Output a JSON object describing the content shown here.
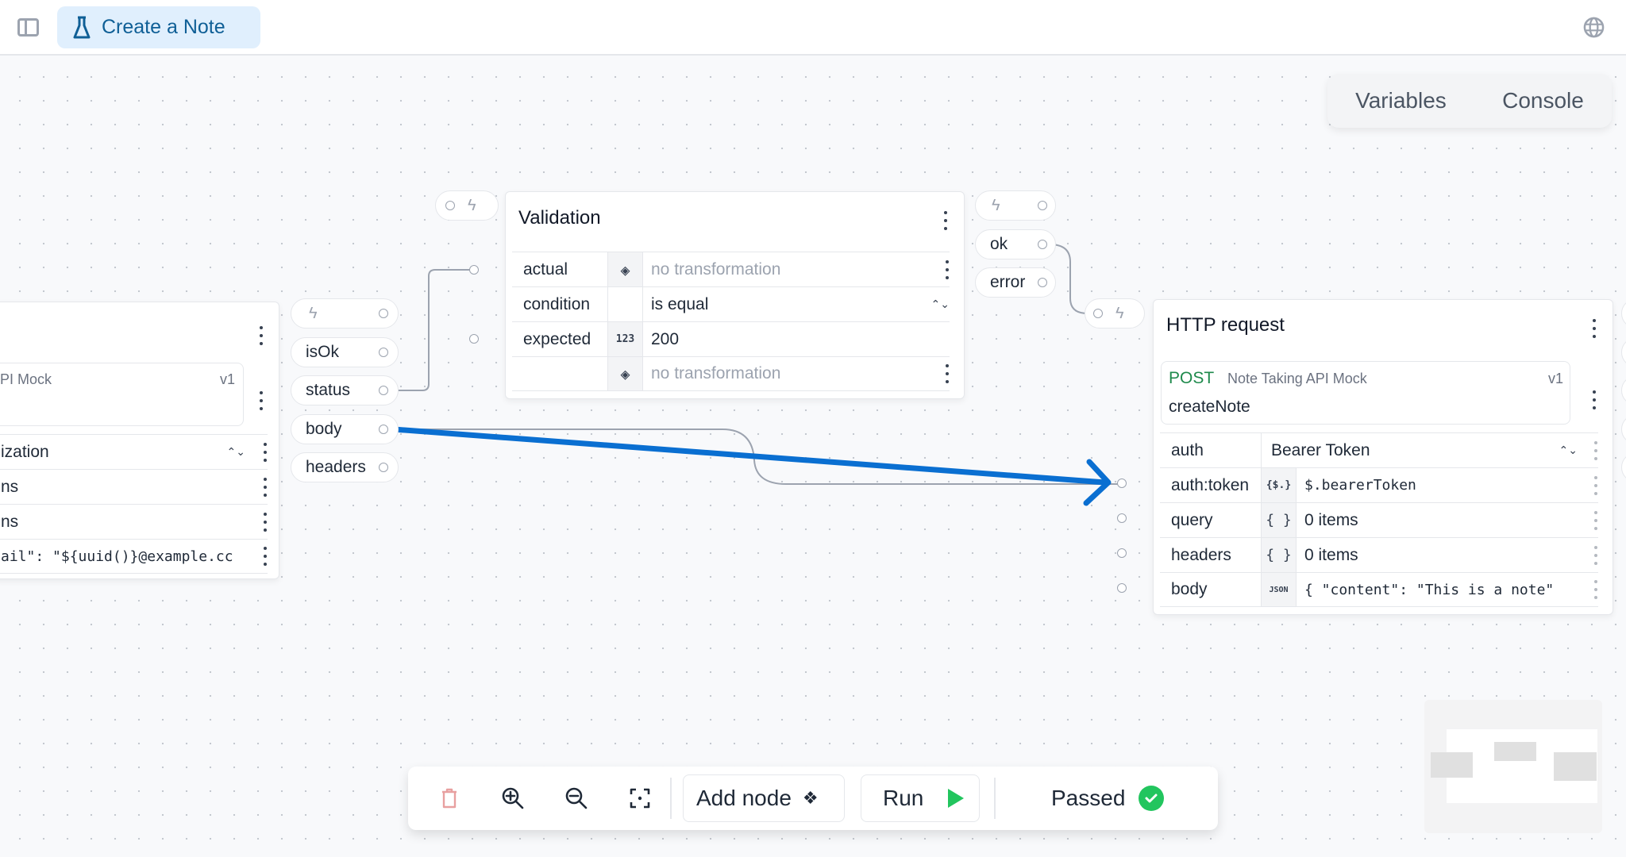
{
  "topbar": {
    "sidebar_toggle_icon": "sidebar-toggle-icon",
    "active_tab": {
      "label": "Create a Note",
      "icon": "flask-icon"
    },
    "language_icon": "globe-icon"
  },
  "panel_tabs": [
    "Variables",
    "Console"
  ],
  "left_node": {
    "service_fragment": "PI Mock",
    "version": "v1",
    "rows": [
      {
        "value_fragment": "ization"
      },
      {
        "value_fragment": "ns"
      },
      {
        "value_fragment": "ns"
      },
      {
        "value_fragment": "ail\": \"${uuid()}@example.cc"
      }
    ],
    "outputs": [
      {
        "label": "",
        "icon": "bolt-icon"
      },
      {
        "label": "isOk"
      },
      {
        "label": "status"
      },
      {
        "label": "body"
      },
      {
        "label": "headers"
      }
    ]
  },
  "validation_node": {
    "title": "Validation",
    "rows": [
      {
        "label": "actual",
        "icon": "transform-icon",
        "value": "no transformation",
        "placeholder": true
      },
      {
        "label": "condition",
        "icon": "",
        "value": "is equal",
        "select": true
      },
      {
        "label": "expected",
        "icon": "123",
        "value": "200"
      },
      {
        "label": "",
        "icon": "transform-icon",
        "value": "no transformation",
        "placeholder": true
      }
    ],
    "outputs": [
      {
        "label": "",
        "icon": "bolt-icon"
      },
      {
        "label": "ok"
      },
      {
        "label": "error"
      }
    ]
  },
  "http_node": {
    "title": "HTTP request",
    "method": "POST",
    "service": "Note Taking API Mock",
    "version": "v1",
    "operation": "createNote",
    "rows": [
      {
        "label": "auth",
        "icon": "",
        "value": "Bearer Token",
        "select": true
      },
      {
        "label": "auth:token",
        "icon": "{$.}",
        "value": "$.bearerToken",
        "mono": true
      },
      {
        "label": "query",
        "icon": "{ }",
        "value": "0 items"
      },
      {
        "label": "headers",
        "icon": "{ }",
        "value": "0 items"
      },
      {
        "label": "body",
        "icon": "JSON",
        "value": "{ \"content\": \"This is a note\"",
        "mono": true
      }
    ]
  },
  "toolbar": {
    "delete_icon": "trash-icon",
    "zoom_in_icon": "zoom-in-icon",
    "zoom_out_icon": "zoom-out-icon",
    "fit_icon": "fit-view-icon",
    "add_node_label": "Add node",
    "run_label": "Run",
    "status_label": "Passed"
  },
  "colors": {
    "accent": "#0f5f96",
    "tab_bg": "#e0effd",
    "success": "#22c55e",
    "method_post": "#1f8a4c",
    "annotation_arrow": "#0a6fd1",
    "delete": "#e8a0a0"
  }
}
